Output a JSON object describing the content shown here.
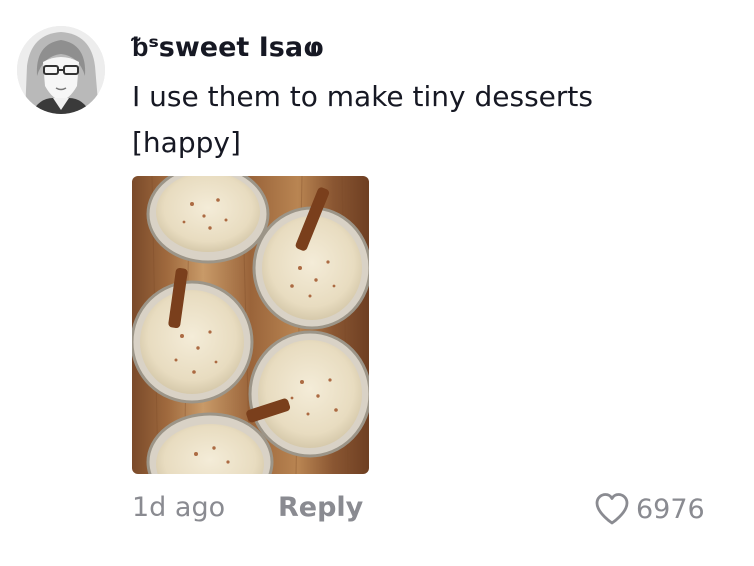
{
  "comment": {
    "username": "ᵬˢsweet Isaⱷ",
    "text": "I use them to make tiny desserts [happy]",
    "image_alt": "rice pudding in small glass cups with cinnamon sticks",
    "timestamp": "1d ago",
    "reply_label": "Reply",
    "like_count": "6976"
  },
  "icons": {
    "like": "heart-outline-icon",
    "avatar": "anime-avatar"
  },
  "colors": {
    "text": "#161823",
    "muted": "#8a8b91"
  }
}
